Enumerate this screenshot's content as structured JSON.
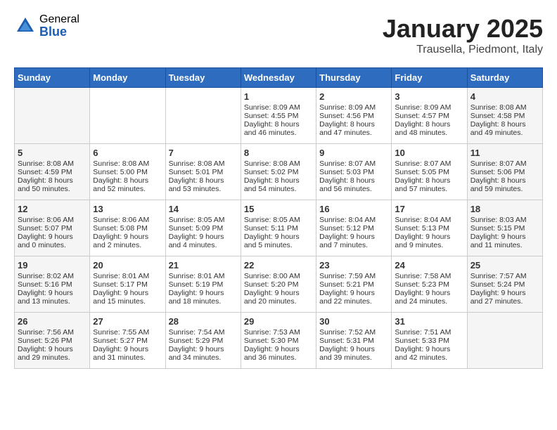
{
  "header": {
    "logo_general": "General",
    "logo_blue": "Blue",
    "month_year": "January 2025",
    "location": "Trausella, Piedmont, Italy"
  },
  "days_of_week": [
    "Sunday",
    "Monday",
    "Tuesday",
    "Wednesday",
    "Thursday",
    "Friday",
    "Saturday"
  ],
  "weeks": [
    [
      {
        "day": "",
        "content": ""
      },
      {
        "day": "",
        "content": ""
      },
      {
        "day": "",
        "content": ""
      },
      {
        "day": "1",
        "content": "Sunrise: 8:09 AM\nSunset: 4:55 PM\nDaylight: 8 hours\nand 46 minutes."
      },
      {
        "day": "2",
        "content": "Sunrise: 8:09 AM\nSunset: 4:56 PM\nDaylight: 8 hours\nand 47 minutes."
      },
      {
        "day": "3",
        "content": "Sunrise: 8:09 AM\nSunset: 4:57 PM\nDaylight: 8 hours\nand 48 minutes."
      },
      {
        "day": "4",
        "content": "Sunrise: 8:08 AM\nSunset: 4:58 PM\nDaylight: 8 hours\nand 49 minutes."
      }
    ],
    [
      {
        "day": "5",
        "content": "Sunrise: 8:08 AM\nSunset: 4:59 PM\nDaylight: 8 hours\nand 50 minutes."
      },
      {
        "day": "6",
        "content": "Sunrise: 8:08 AM\nSunset: 5:00 PM\nDaylight: 8 hours\nand 52 minutes."
      },
      {
        "day": "7",
        "content": "Sunrise: 8:08 AM\nSunset: 5:01 PM\nDaylight: 8 hours\nand 53 minutes."
      },
      {
        "day": "8",
        "content": "Sunrise: 8:08 AM\nSunset: 5:02 PM\nDaylight: 8 hours\nand 54 minutes."
      },
      {
        "day": "9",
        "content": "Sunrise: 8:07 AM\nSunset: 5:03 PM\nDaylight: 8 hours\nand 56 minutes."
      },
      {
        "day": "10",
        "content": "Sunrise: 8:07 AM\nSunset: 5:05 PM\nDaylight: 8 hours\nand 57 minutes."
      },
      {
        "day": "11",
        "content": "Sunrise: 8:07 AM\nSunset: 5:06 PM\nDaylight: 8 hours\nand 59 minutes."
      }
    ],
    [
      {
        "day": "12",
        "content": "Sunrise: 8:06 AM\nSunset: 5:07 PM\nDaylight: 9 hours\nand 0 minutes."
      },
      {
        "day": "13",
        "content": "Sunrise: 8:06 AM\nSunset: 5:08 PM\nDaylight: 9 hours\nand 2 minutes."
      },
      {
        "day": "14",
        "content": "Sunrise: 8:05 AM\nSunset: 5:09 PM\nDaylight: 9 hours\nand 4 minutes."
      },
      {
        "day": "15",
        "content": "Sunrise: 8:05 AM\nSunset: 5:11 PM\nDaylight: 9 hours\nand 5 minutes."
      },
      {
        "day": "16",
        "content": "Sunrise: 8:04 AM\nSunset: 5:12 PM\nDaylight: 9 hours\nand 7 minutes."
      },
      {
        "day": "17",
        "content": "Sunrise: 8:04 AM\nSunset: 5:13 PM\nDaylight: 9 hours\nand 9 minutes."
      },
      {
        "day": "18",
        "content": "Sunrise: 8:03 AM\nSunset: 5:15 PM\nDaylight: 9 hours\nand 11 minutes."
      }
    ],
    [
      {
        "day": "19",
        "content": "Sunrise: 8:02 AM\nSunset: 5:16 PM\nDaylight: 9 hours\nand 13 minutes."
      },
      {
        "day": "20",
        "content": "Sunrise: 8:01 AM\nSunset: 5:17 PM\nDaylight: 9 hours\nand 15 minutes."
      },
      {
        "day": "21",
        "content": "Sunrise: 8:01 AM\nSunset: 5:19 PM\nDaylight: 9 hours\nand 18 minutes."
      },
      {
        "day": "22",
        "content": "Sunrise: 8:00 AM\nSunset: 5:20 PM\nDaylight: 9 hours\nand 20 minutes."
      },
      {
        "day": "23",
        "content": "Sunrise: 7:59 AM\nSunset: 5:21 PM\nDaylight: 9 hours\nand 22 minutes."
      },
      {
        "day": "24",
        "content": "Sunrise: 7:58 AM\nSunset: 5:23 PM\nDaylight: 9 hours\nand 24 minutes."
      },
      {
        "day": "25",
        "content": "Sunrise: 7:57 AM\nSunset: 5:24 PM\nDaylight: 9 hours\nand 27 minutes."
      }
    ],
    [
      {
        "day": "26",
        "content": "Sunrise: 7:56 AM\nSunset: 5:26 PM\nDaylight: 9 hours\nand 29 minutes."
      },
      {
        "day": "27",
        "content": "Sunrise: 7:55 AM\nSunset: 5:27 PM\nDaylight: 9 hours\nand 31 minutes."
      },
      {
        "day": "28",
        "content": "Sunrise: 7:54 AM\nSunset: 5:29 PM\nDaylight: 9 hours\nand 34 minutes."
      },
      {
        "day": "29",
        "content": "Sunrise: 7:53 AM\nSunset: 5:30 PM\nDaylight: 9 hours\nand 36 minutes."
      },
      {
        "day": "30",
        "content": "Sunrise: 7:52 AM\nSunset: 5:31 PM\nDaylight: 9 hours\nand 39 minutes."
      },
      {
        "day": "31",
        "content": "Sunrise: 7:51 AM\nSunset: 5:33 PM\nDaylight: 9 hours\nand 42 minutes."
      },
      {
        "day": "",
        "content": ""
      }
    ]
  ]
}
